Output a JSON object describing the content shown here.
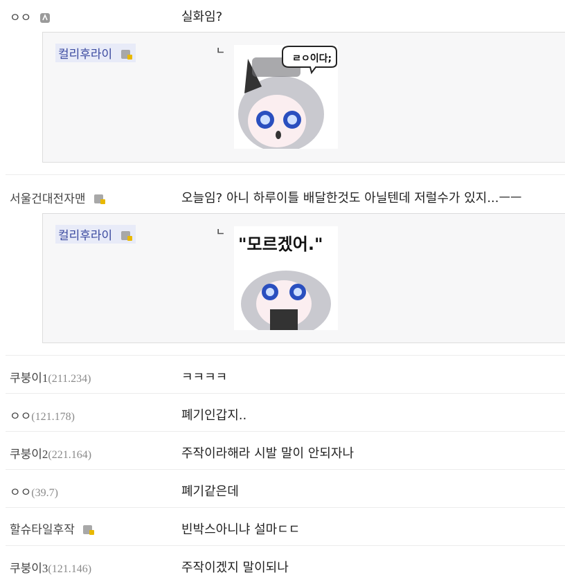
{
  "comments": [
    {
      "nick": "ㅇㅇ",
      "msg": "실화임?",
      "reply": {
        "nick": "컬리후라이",
        "sticker_text": "ㄹㅇ이다;"
      }
    },
    {
      "nick": "서울건대전자맨",
      "msg": "오늘임? 아니 하루이틀 배달한것도 아닐텐데 저럴수가 있지...ㅡㅡ",
      "reply": {
        "nick": "컬리후라이",
        "sticker_text": "\"모르겠어.\""
      }
    },
    {
      "nick": "쿠붕이",
      "num": "1",
      "ip": "(211.234)",
      "msg": "ㅋㅋㅋㅋ"
    },
    {
      "nick": "ㅇㅇ",
      "ip": "(121.178)",
      "msg": "폐기인갑지.."
    },
    {
      "nick": "쿠붕이",
      "num": "2",
      "ip": "(221.164)",
      "msg": "주작이라해라 시발 말이 안되자나"
    },
    {
      "nick": "ㅇㅇ",
      "ip": "(39.7)",
      "msg": "폐기같은데"
    },
    {
      "nick": "할슈타일후작",
      "msg": "빈박스아니냐 설마ㄷㄷ"
    },
    {
      "nick": "쿠붕이",
      "num": "3",
      "ip": "(121.146)",
      "msg": "주작이겠지 말이되나"
    }
  ],
  "reply_mark": "ㄴ",
  "colors": {
    "border": "#ececec",
    "reply_bg": "#f7f7f8",
    "nick_highlight": "#e8ebf8"
  },
  "icons": [
    "fixed-nick-icon",
    "fixed-nick-lock-icon"
  ]
}
